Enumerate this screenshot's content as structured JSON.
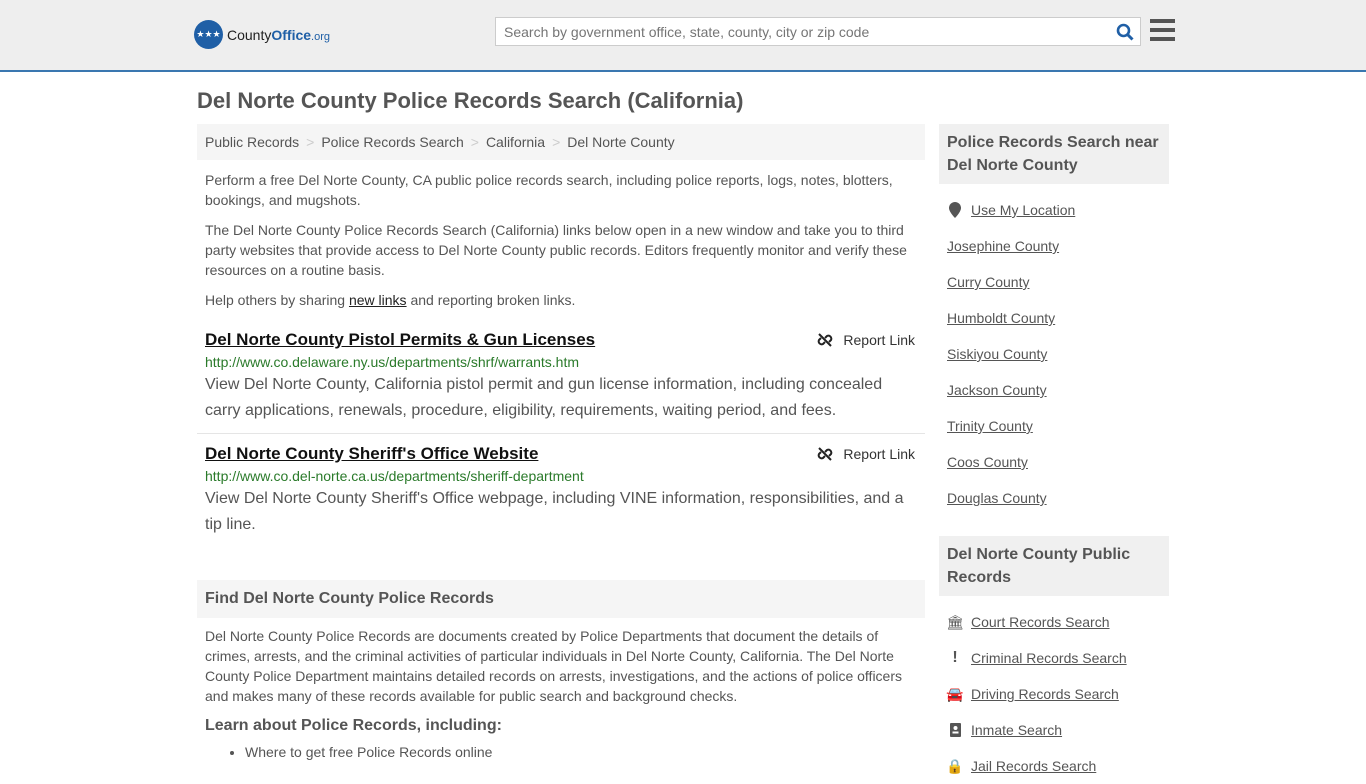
{
  "header": {
    "logo_county": "County",
    "logo_office": "Office",
    "logo_org": ".org",
    "search_placeholder": "Search by government office, state, county, city or zip code"
  },
  "page_title": "Del Norte County Police Records Search (California)",
  "breadcrumb": [
    "Public Records",
    "Police Records Search",
    "California",
    "Del Norte County"
  ],
  "intro": {
    "p1": "Perform a free Del Norte County, CA public police records search, including police reports, logs, notes, blotters, bookings, and mugshots.",
    "p2": "The Del Norte County Police Records Search (California) links below open in a new window and take you to third party websites that provide access to Del Norte County public records. Editors frequently monitor and verify these resources on a routine basis.",
    "p3_pre": "Help others by sharing ",
    "p3_link": "new links",
    "p3_post": " and reporting broken links."
  },
  "entries": [
    {
      "title": "Del Norte County Pistol Permits & Gun Licenses",
      "url": "http://www.co.delaware.ny.us/departments/shrf/warrants.htm",
      "desc": "View Del Norte County, California pistol permit and gun license information, including concealed carry applications, renewals, procedure, eligibility, requirements, waiting period, and fees.",
      "report": "Report Link"
    },
    {
      "title": "Del Norte County Sheriff's Office Website",
      "url": "http://www.co.del-norte.ca.us/departments/sheriff-department",
      "desc": "View Del Norte County Sheriff's Office webpage, including VINE information, responsibilities, and a tip line.",
      "report": "Report Link"
    }
  ],
  "find": {
    "heading": "Find Del Norte County Police Records",
    "text": "Del Norte County Police Records are documents created by Police Departments that document the details of crimes, arrests, and the criminal activities of particular individuals in Del Norte County, California. The Del Norte County Police Department maintains detailed records on arrests, investigations, and the actions of police officers and makes many of these records available for public search and background checks.",
    "learn": "Learn about Police Records, including:",
    "bullets": [
      "Where to get free Police Records online"
    ]
  },
  "sidebar": {
    "near_heading": "Police Records Search near Del Norte County",
    "use_location": "Use My Location",
    "near": [
      "Josephine County",
      "Curry County",
      "Humboldt County",
      "Siskiyou County",
      "Jackson County",
      "Trinity County",
      "Coos County",
      "Douglas County"
    ],
    "public_heading": "Del Norte County Public Records",
    "public": [
      {
        "label": "Court Records Search",
        "icon": "courthouse-icon"
      },
      {
        "label": "Criminal Records Search",
        "icon": "exclamation-icon"
      },
      {
        "label": "Driving Records Search",
        "icon": "car-icon"
      },
      {
        "label": "Inmate Search",
        "icon": "id-badge-icon"
      },
      {
        "label": "Jail Records Search",
        "icon": "lock-icon"
      }
    ]
  }
}
